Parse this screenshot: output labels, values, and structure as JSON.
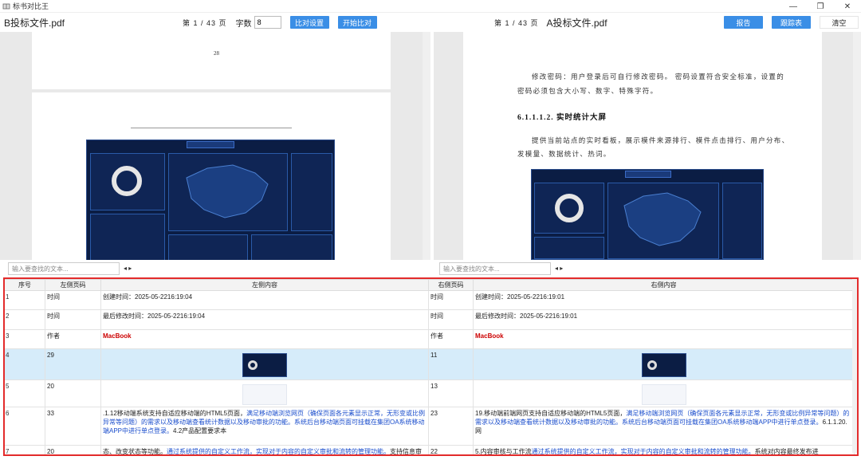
{
  "window": {
    "title": "标书对比王",
    "minimize": "—",
    "maximize": "❐",
    "close": "✕"
  },
  "left": {
    "file_name": "B投标文件.pdf",
    "page_info": "第 1 / 43 页",
    "char_label": "字数",
    "char_value": "8",
    "btn_settings": "比对设置",
    "btn_start": "开始比对",
    "page_number": "28",
    "search_placeholder": "输入要查找的文本...",
    "arrows": "◂ ▸"
  },
  "right": {
    "page_info": "第 1 / 43 页",
    "file_name": "A投标文件.pdf",
    "btn_report": "报告",
    "btn_diff": "跟踪表",
    "btn_clear": "清空",
    "para1_l1": "修改密码：用户登录后可自行修改密码。 密码设置符合安全标准，设置的",
    "para1_l2": "密码必须包含大小写、数字、特殊字符。",
    "heading": "6.1.1.1.2.  实时统计大屏",
    "para2_l1": "提供当前站点的实时看板，展示模件来源排行、模件点击排行、用户分布、",
    "para2_l2": "发模量、数据统计、热词。",
    "search_placeholder": "输入要查找的文本...",
    "arrows": "◂ ▸"
  },
  "table": {
    "headers": [
      "序号",
      "左侧页码",
      "左侧内容",
      "右侧页码",
      "右侧内容"
    ],
    "rows": [
      {
        "idx": "1",
        "lp": "时间",
        "lc": "创建时间：2025-05-2216:19:04",
        "rp": "时间",
        "rc": "创建时间：2025-05-2216:19:01"
      },
      {
        "idx": "2",
        "lp": "时间",
        "lc": "最后修改时间：2025-05-2216:19:04",
        "rp": "时间",
        "rc": "最后修改时间：2025-05-2216:19:01"
      },
      {
        "idx": "3",
        "lp": "作者",
        "lc": "MacBook",
        "rp": "作者",
        "rc": "MacBook"
      },
      {
        "idx": "4",
        "lp": "29",
        "lc": "",
        "rp": "11",
        "rc": ""
      },
      {
        "idx": "5",
        "lp": "20",
        "lc": "",
        "rp": "13",
        "rc": ""
      },
      {
        "idx": "6",
        "lp": "33",
        "lc_a": ".1.12移动端系统支持自适应移动端的HTML5页面，",
        "lc_b": "满足移动端浏览网页（确保页面各元素显示正常，无形变或比例异常等问题）的需求以及移动端查看统计数据以及移动审批的功能。系统后台移动端页面可挂载在集团OA系统移动端APP中进行单点登录。",
        "lc_c": "4.2产品配置要求本",
        "rp": "23",
        "rc_a": "19.移动端前端网页支持自适应移动端的HTML5页面，",
        "rc_b": "满足移动端浏览网页（确保页面各元素显示正常，无形变或比例异常等问题）的需求以及移动端查看统计数据以及移动审批的功能。系统后台移动端页面可挂载在集团OA系统移动端APP中进行单点登录。",
        "rc_c": "6.1.1.20.网"
      },
      {
        "idx": "7",
        "lp": "20",
        "lc_a": "态、改变状态等功能。",
        "lc_b": "通过系统提供的自定义工作流，实现对于内容的自定义审批和流转的管理功能。",
        "lc_c": "支持信息审批的工作流",
        "rp": "22",
        "rc_a": "5.内容审核与工作流",
        "rc_b": "通过系统提供的自定义工作流，实现对于内容的自定义审批和流转的管理功能。",
        "rc_c": "系统对内容最终发布进"
      }
    ]
  },
  "colors": {
    "accent": "#3a8ee6",
    "highlight_box": "#e32b2b",
    "selected_row": "#d6ecfa",
    "match_text": "#1a4dcc",
    "author_text": "#c00000"
  }
}
